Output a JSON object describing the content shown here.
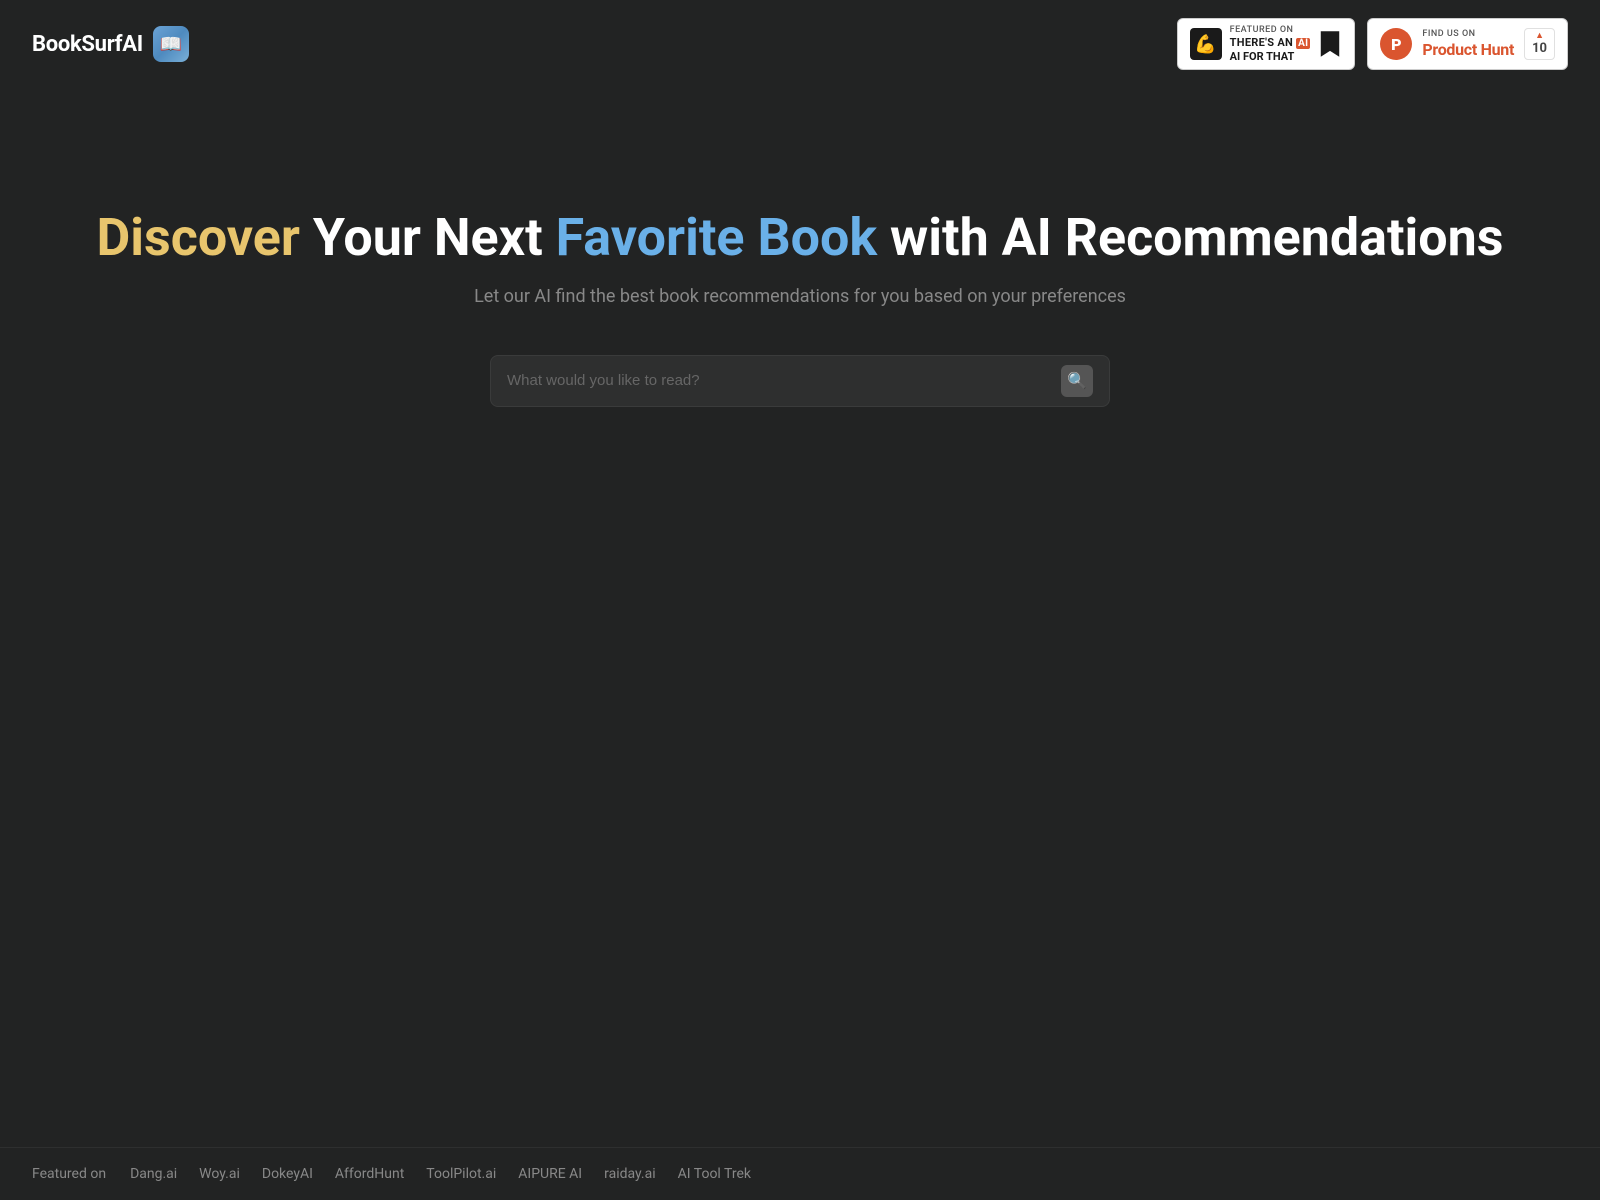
{
  "header": {
    "logo_text": "BookSurfAI",
    "logo_icon": "📖",
    "badge_ai_for_that": {
      "featured_on_label": "Featured on",
      "title_line1": "THERE'S AN",
      "title_line2": "AI FOR THAT",
      "ai_icon": "💪"
    },
    "badge_product_hunt": {
      "find_us_label": "FIND US ON",
      "title": "Product Hunt",
      "count": "10"
    }
  },
  "hero": {
    "title_part1": "Discover",
    "title_part2": " Your Next ",
    "title_part3": "Favorite Book",
    "title_part4": " with AI Recommendations",
    "subtitle": "Let our AI find the best book recommendations for you based on your preferences",
    "search_placeholder": "What would you like to read?"
  },
  "footer": {
    "featured_on_label": "Featured on",
    "links": [
      {
        "label": "Dang.ai"
      },
      {
        "label": "Woy.ai"
      },
      {
        "label": "DokeyAI"
      },
      {
        "label": "AffordHunt"
      },
      {
        "label": "ToolPilot.ai"
      },
      {
        "label": "AIPURE AI"
      },
      {
        "label": "raiday.ai"
      },
      {
        "label": "AI Tool Trek"
      }
    ]
  }
}
